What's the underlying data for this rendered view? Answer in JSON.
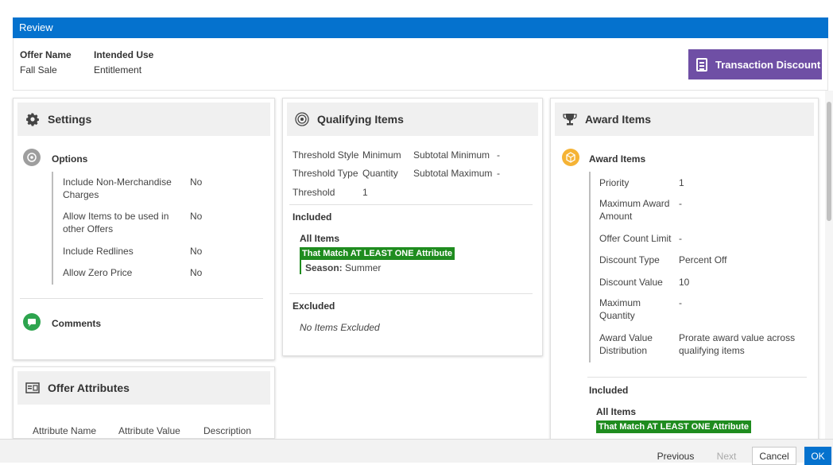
{
  "window": {
    "title": "Review"
  },
  "summary": {
    "offer_name_label": "Offer Name",
    "offer_name_value": "Fall Sale",
    "intended_use_label": "Intended Use",
    "intended_use_value": "Entitlement",
    "badge_label": "Transaction Discount"
  },
  "settings": {
    "title": "Settings",
    "options_title": "Options",
    "options": [
      {
        "label": "Include Non-Merchandise Charges",
        "value": "No"
      },
      {
        "label": "Allow Items to be used in other Offers",
        "value": "No"
      },
      {
        "label": "Include Redlines",
        "value": "No"
      },
      {
        "label": "Allow Zero Price",
        "value": "No"
      }
    ],
    "comments_title": "Comments"
  },
  "offer_attributes": {
    "title": "Offer Attributes",
    "columns": [
      "Attribute Name",
      "Attribute Value",
      "Description"
    ]
  },
  "qualifying": {
    "title": "Qualifying Items",
    "threshold_style_label": "Threshold Style",
    "threshold_style_value": "Minimum",
    "subtotal_min_label": "Subtotal Minimum",
    "subtotal_min_value": "-",
    "threshold_type_label": "Threshold Type",
    "threshold_type_value": "Quantity",
    "subtotal_max_label": "Subtotal Maximum",
    "subtotal_max_value": "-",
    "threshold_label": "Threshold",
    "threshold_value": "1",
    "included_title": "Included",
    "all_items": "All Items",
    "match_label": "That Match AT LEAST ONE Attribute",
    "attr_name": "Season:",
    "attr_value": "Summer",
    "excluded_title": "Excluded",
    "excluded_text": "No Items Excluded"
  },
  "award": {
    "title": "Award Items",
    "section_title": "Award Items",
    "rows": [
      {
        "label": "Priority",
        "value": "1"
      },
      {
        "label": "Maximum Award Amount",
        "value": "-"
      },
      {
        "label": "Offer Count Limit",
        "value": "-"
      },
      {
        "label": "Discount Type",
        "value": "Percent Off"
      },
      {
        "label": "Discount Value",
        "value": "10"
      },
      {
        "label": "Maximum Quantity",
        "value": "-"
      },
      {
        "label": "Award Value Distribution",
        "value": "Prorate award value across qualifying items"
      }
    ],
    "included_title": "Included",
    "all_items": "All Items",
    "match_label": "That Match AT LEAST ONE Attribute"
  },
  "footer": {
    "previous": "Previous",
    "next": "Next",
    "cancel": "Cancel",
    "ok": "OK"
  },
  "colors": {
    "header_blue": "#0572ce",
    "badge_purple": "#6f4fa5",
    "match_green": "#1f8c1f",
    "award_orange": "#f5b335",
    "comments_green": "#2da44e"
  }
}
